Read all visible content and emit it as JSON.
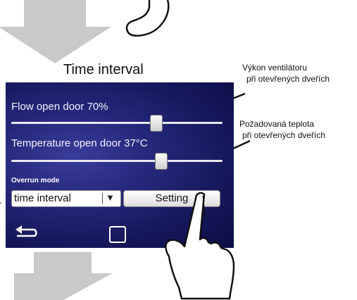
{
  "header": {
    "title": "Time interval"
  },
  "annotations": {
    "flow": [
      "Výkon ventilátoru",
      "při otevřených dveřích"
    ],
    "temperature": [
      "Požadovaná teplota",
      "při otevřených dveřích"
    ]
  },
  "screen": {
    "flow": {
      "label": "Flow open door 70%",
      "value_percent": 70
    },
    "temperature": {
      "label": "Temperature open door 37°C",
      "value_c": 37
    },
    "overrun": {
      "label": "Overrun mode",
      "selected": "time interval"
    },
    "setting_button": "Setting"
  },
  "colors": {
    "screen_bg": "#25287a",
    "arrow_grey": "#c9c9c9"
  },
  "icons": [
    "back-arrow-icon",
    "home-square-icon",
    "pointing-hand-icon",
    "chevron-down-icon"
  ]
}
